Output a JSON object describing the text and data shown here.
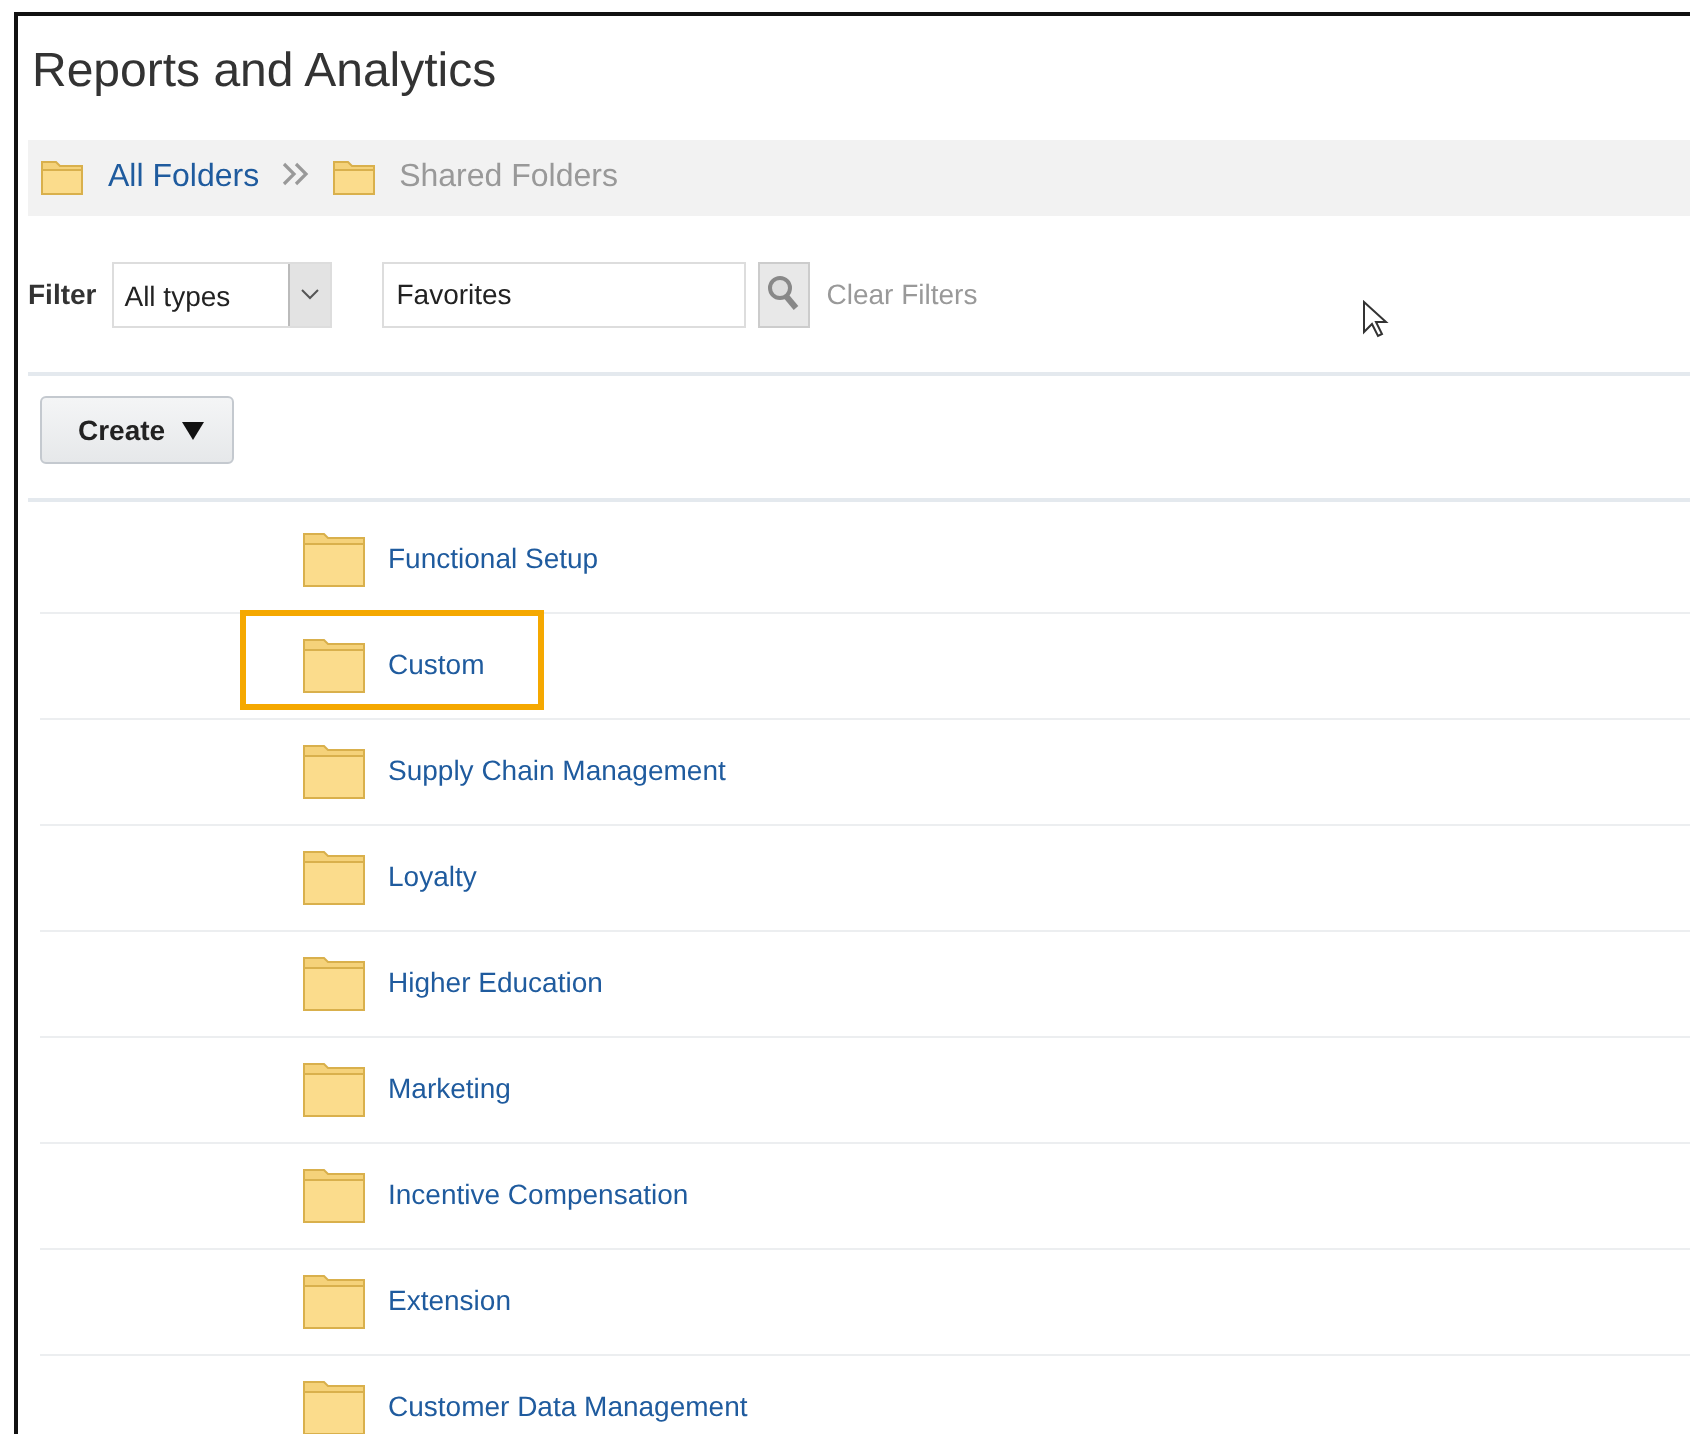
{
  "page": {
    "title": "Reports and Analytics"
  },
  "breadcrumb": [
    {
      "label": "All Folders",
      "current": false
    },
    {
      "label": "Shared Folders",
      "current": true
    }
  ],
  "filter": {
    "label": "Filter",
    "type_select": {
      "value": "All types"
    },
    "search_field": {
      "value": "Favorites"
    },
    "clear_link": "Clear Filters"
  },
  "create_button": {
    "label": "Create"
  },
  "folders": [
    {
      "name": "Functional Setup",
      "highlighted": false
    },
    {
      "name": "Custom",
      "highlighted": true
    },
    {
      "name": "Supply Chain Management",
      "highlighted": false
    },
    {
      "name": "Loyalty",
      "highlighted": false
    },
    {
      "name": "Higher Education",
      "highlighted": false
    },
    {
      "name": "Marketing",
      "highlighted": false
    },
    {
      "name": "Incentive Compensation",
      "highlighted": false
    },
    {
      "name": "Extension",
      "highlighted": false
    },
    {
      "name": "Customer Data Management",
      "highlighted": false
    }
  ]
}
